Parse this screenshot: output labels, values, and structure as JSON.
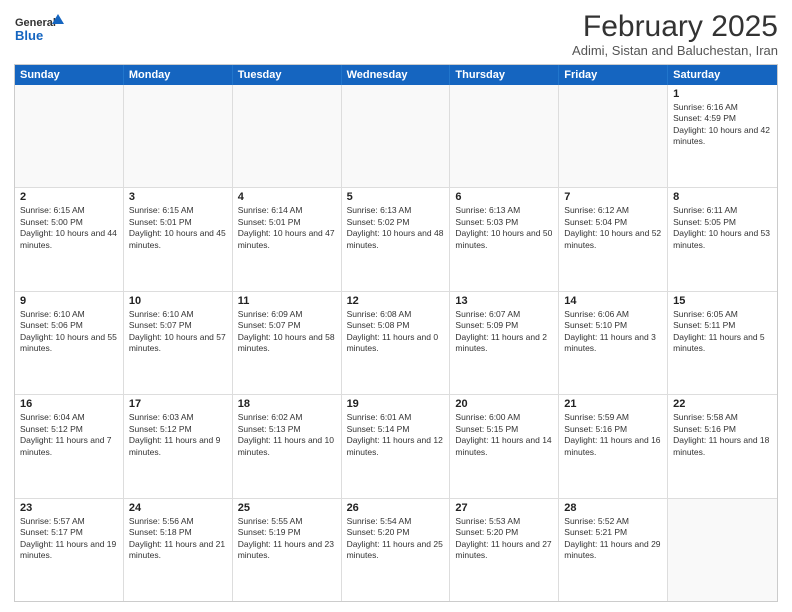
{
  "header": {
    "logo_line1": "General",
    "logo_line2": "Blue",
    "month_title": "February 2025",
    "location": "Adimi, Sistan and Baluchestan, Iran"
  },
  "weekdays": [
    "Sunday",
    "Monday",
    "Tuesday",
    "Wednesday",
    "Thursday",
    "Friday",
    "Saturday"
  ],
  "rows": [
    [
      {
        "day": "",
        "info": ""
      },
      {
        "day": "",
        "info": ""
      },
      {
        "day": "",
        "info": ""
      },
      {
        "day": "",
        "info": ""
      },
      {
        "day": "",
        "info": ""
      },
      {
        "day": "",
        "info": ""
      },
      {
        "day": "1",
        "info": "Sunrise: 6:16 AM\nSunset: 4:59 PM\nDaylight: 10 hours and 42 minutes."
      }
    ],
    [
      {
        "day": "2",
        "info": "Sunrise: 6:15 AM\nSunset: 5:00 PM\nDaylight: 10 hours and 44 minutes."
      },
      {
        "day": "3",
        "info": "Sunrise: 6:15 AM\nSunset: 5:01 PM\nDaylight: 10 hours and 45 minutes."
      },
      {
        "day": "4",
        "info": "Sunrise: 6:14 AM\nSunset: 5:01 PM\nDaylight: 10 hours and 47 minutes."
      },
      {
        "day": "5",
        "info": "Sunrise: 6:13 AM\nSunset: 5:02 PM\nDaylight: 10 hours and 48 minutes."
      },
      {
        "day": "6",
        "info": "Sunrise: 6:13 AM\nSunset: 5:03 PM\nDaylight: 10 hours and 50 minutes."
      },
      {
        "day": "7",
        "info": "Sunrise: 6:12 AM\nSunset: 5:04 PM\nDaylight: 10 hours and 52 minutes."
      },
      {
        "day": "8",
        "info": "Sunrise: 6:11 AM\nSunset: 5:05 PM\nDaylight: 10 hours and 53 minutes."
      }
    ],
    [
      {
        "day": "9",
        "info": "Sunrise: 6:10 AM\nSunset: 5:06 PM\nDaylight: 10 hours and 55 minutes."
      },
      {
        "day": "10",
        "info": "Sunrise: 6:10 AM\nSunset: 5:07 PM\nDaylight: 10 hours and 57 minutes."
      },
      {
        "day": "11",
        "info": "Sunrise: 6:09 AM\nSunset: 5:07 PM\nDaylight: 10 hours and 58 minutes."
      },
      {
        "day": "12",
        "info": "Sunrise: 6:08 AM\nSunset: 5:08 PM\nDaylight: 11 hours and 0 minutes."
      },
      {
        "day": "13",
        "info": "Sunrise: 6:07 AM\nSunset: 5:09 PM\nDaylight: 11 hours and 2 minutes."
      },
      {
        "day": "14",
        "info": "Sunrise: 6:06 AM\nSunset: 5:10 PM\nDaylight: 11 hours and 3 minutes."
      },
      {
        "day": "15",
        "info": "Sunrise: 6:05 AM\nSunset: 5:11 PM\nDaylight: 11 hours and 5 minutes."
      }
    ],
    [
      {
        "day": "16",
        "info": "Sunrise: 6:04 AM\nSunset: 5:12 PM\nDaylight: 11 hours and 7 minutes."
      },
      {
        "day": "17",
        "info": "Sunrise: 6:03 AM\nSunset: 5:12 PM\nDaylight: 11 hours and 9 minutes."
      },
      {
        "day": "18",
        "info": "Sunrise: 6:02 AM\nSunset: 5:13 PM\nDaylight: 11 hours and 10 minutes."
      },
      {
        "day": "19",
        "info": "Sunrise: 6:01 AM\nSunset: 5:14 PM\nDaylight: 11 hours and 12 minutes."
      },
      {
        "day": "20",
        "info": "Sunrise: 6:00 AM\nSunset: 5:15 PM\nDaylight: 11 hours and 14 minutes."
      },
      {
        "day": "21",
        "info": "Sunrise: 5:59 AM\nSunset: 5:16 PM\nDaylight: 11 hours and 16 minutes."
      },
      {
        "day": "22",
        "info": "Sunrise: 5:58 AM\nSunset: 5:16 PM\nDaylight: 11 hours and 18 minutes."
      }
    ],
    [
      {
        "day": "23",
        "info": "Sunrise: 5:57 AM\nSunset: 5:17 PM\nDaylight: 11 hours and 19 minutes."
      },
      {
        "day": "24",
        "info": "Sunrise: 5:56 AM\nSunset: 5:18 PM\nDaylight: 11 hours and 21 minutes."
      },
      {
        "day": "25",
        "info": "Sunrise: 5:55 AM\nSunset: 5:19 PM\nDaylight: 11 hours and 23 minutes."
      },
      {
        "day": "26",
        "info": "Sunrise: 5:54 AM\nSunset: 5:20 PM\nDaylight: 11 hours and 25 minutes."
      },
      {
        "day": "27",
        "info": "Sunrise: 5:53 AM\nSunset: 5:20 PM\nDaylight: 11 hours and 27 minutes."
      },
      {
        "day": "28",
        "info": "Sunrise: 5:52 AM\nSunset: 5:21 PM\nDaylight: 11 hours and 29 minutes."
      },
      {
        "day": "",
        "info": ""
      }
    ]
  ]
}
